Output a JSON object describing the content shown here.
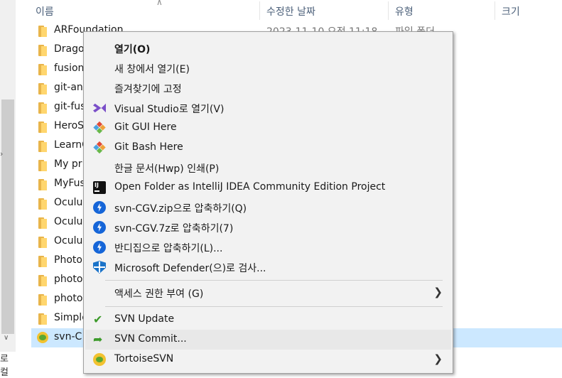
{
  "left_panel": {
    "label": "로컬"
  },
  "header": {
    "col_name": "이름",
    "col_date": "수정한 날짜",
    "col_type": "유형",
    "col_size": "크기"
  },
  "rows": [
    {
      "name": "ARFoundation",
      "date": "2023-11-10 오전 11:18",
      "type": "파일 폴더"
    },
    {
      "name": "Drago"
    },
    {
      "name": "fusion"
    },
    {
      "name": "git-an"
    },
    {
      "name": "git-fus"
    },
    {
      "name": "HeroS"
    },
    {
      "name": "LearnC"
    },
    {
      "name": "My pr"
    },
    {
      "name": "MyFus"
    },
    {
      "name": "Oculu"
    },
    {
      "name": "Oculu"
    },
    {
      "name": "Oculu"
    },
    {
      "name": "Photo"
    },
    {
      "name": "photo"
    },
    {
      "name": "photo"
    },
    {
      "name": "Simple"
    },
    {
      "name": "svn-C"
    }
  ],
  "menu": {
    "open": "열기(O)",
    "open_new_window": "새 창에서 열기(E)",
    "pin_quick_access": "즐겨찾기에 고정",
    "open_visual_studio": "Visual Studio로 열기(V)",
    "git_gui": "Git GUI Here",
    "git_bash": "Git Bash Here",
    "hwp_print": "한글 문서(Hwp) 인쇄(P)",
    "open_intellij": "Open Folder as IntelliJ IDEA Community Edition Project",
    "zip_compress": "svn-CGV.zip으로 압축하기(Q)",
    "sevenz_compress": "svn-CGV.7z로 압축하기(7)",
    "bandizip_compress": "반디집으로 압축하기(L)...",
    "defender_scan": "Microsoft Defender(으)로 검사...",
    "grant_access": "액세스 권한 부여 (G)",
    "svn_update": "SVN Update",
    "svn_commit": "SVN Commit...",
    "tortoise_svn": "TortoiseSVN"
  },
  "colors": {
    "selection": "#cce8ff",
    "menu_bg": "#f2f2f2",
    "folder": "#ffd66e",
    "accent_blue": "#1565d8"
  }
}
